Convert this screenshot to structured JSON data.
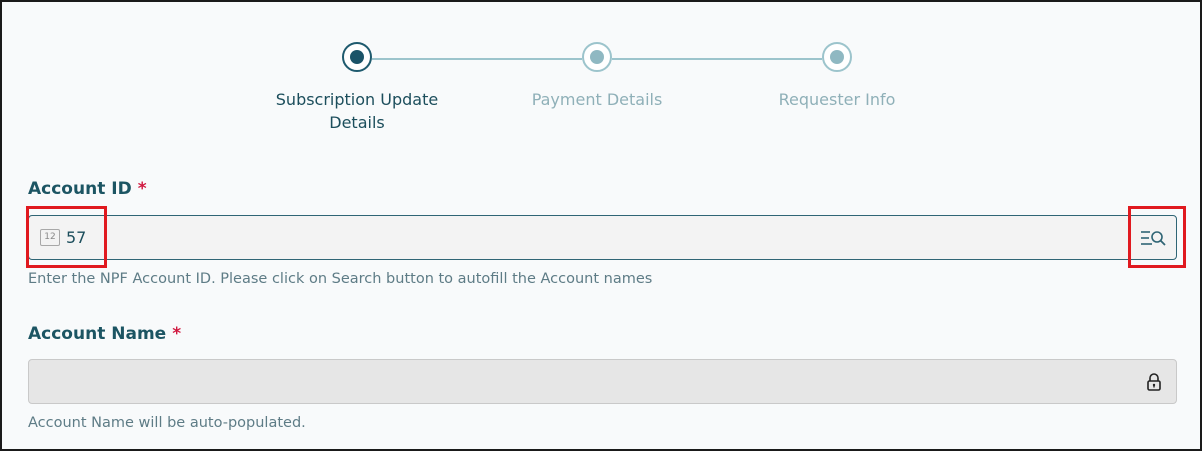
{
  "stepper": {
    "steps": [
      {
        "label_line1": "Subscription Update",
        "label_line2": "Details",
        "state": "active"
      },
      {
        "label_line1": "Payment Details",
        "label_line2": "",
        "state": "inactive"
      },
      {
        "label_line1": "Requester Info",
        "label_line2": "",
        "state": "inactive"
      }
    ]
  },
  "form": {
    "account_id": {
      "label": "Account ID",
      "required_mark": "*",
      "type_icon_text": "12",
      "value": "57",
      "hint": "Enter the NPF Account ID. Please click on Search button to autofill the Account names",
      "search_icon": "list-search-icon"
    },
    "account_name": {
      "label": "Account Name",
      "required_mark": "*",
      "value": "",
      "hint": "Account Name will be auto-populated.",
      "lock_icon": "lock-icon"
    }
  },
  "colors": {
    "accent": "#1c5563",
    "required": "#d0183f",
    "highlight": "#e0191f",
    "step_inactive": "#9cc4cc"
  }
}
